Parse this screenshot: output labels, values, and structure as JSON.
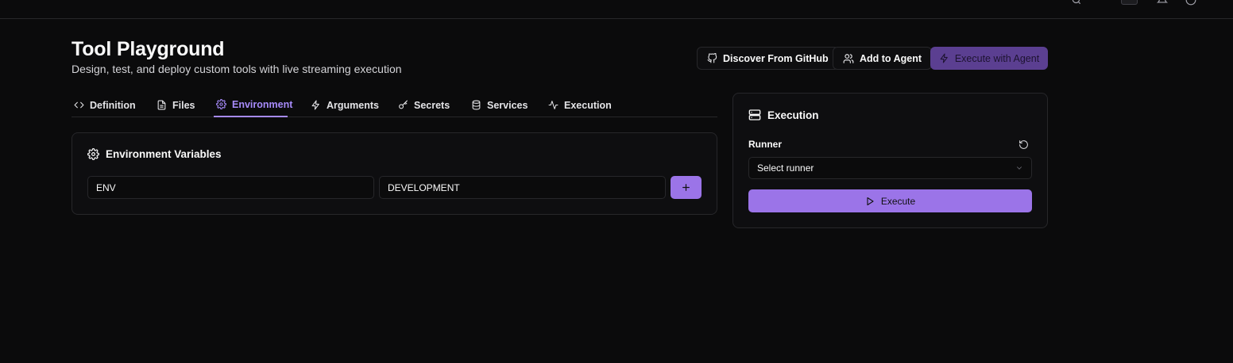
{
  "header": {
    "title": "Tool Playground",
    "subtitle": "Design, test, and deploy custom tools with live streaming execution"
  },
  "actions": {
    "discover": "Discover From GitHub",
    "add_to_agent": "Add to Agent",
    "execute_with_agent": "Execute with Agent"
  },
  "tabs": [
    {
      "label": "Definition",
      "icon": "code-icon"
    },
    {
      "label": "Files",
      "icon": "file-icon"
    },
    {
      "label": "Environment",
      "icon": "gear-icon",
      "active": true
    },
    {
      "label": "Arguments",
      "icon": "bolt-icon"
    },
    {
      "label": "Secrets",
      "icon": "key-icon"
    },
    {
      "label": "Services",
      "icon": "database-icon"
    },
    {
      "label": "Execution",
      "icon": "activity-icon"
    }
  ],
  "environment": {
    "title": "Environment Variables",
    "rows": [
      {
        "key": "ENV",
        "value": "DEVELOPMENT"
      }
    ],
    "add_label": "+"
  },
  "execution_panel": {
    "title": "Execution",
    "runner_label": "Runner",
    "runner_placeholder": "Select runner",
    "execute_label": "Execute"
  },
  "colors": {
    "accent": "#9b74e8",
    "accent_dark": "#5b3f91",
    "background": "#0b0b0c",
    "border": "#27272a"
  }
}
